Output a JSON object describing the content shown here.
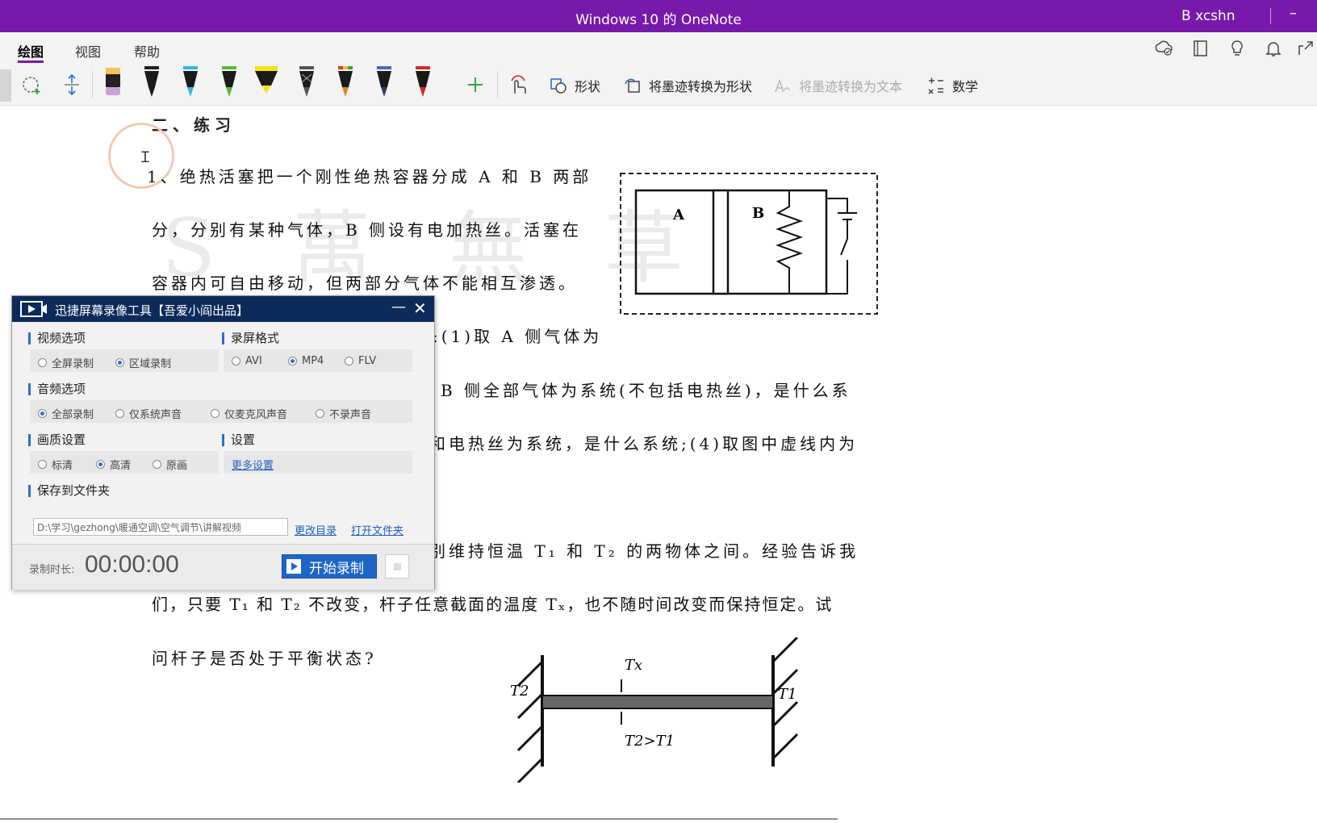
{
  "window": {
    "title": "Windows 10 的 OneNote",
    "user": "B xcshn",
    "minimize_glyph": "–"
  },
  "ribbon": {
    "tabs": [
      {
        "label": "绘图",
        "active": true
      },
      {
        "label": "视图"
      },
      {
        "label": "帮助"
      }
    ],
    "right_icons": [
      "sync-icon",
      "notebook-icon",
      "lightbulb-icon",
      "bell-icon",
      "share-icon"
    ]
  },
  "toolbar": {
    "shapes_label": "形状",
    "ink_to_shape_label": "将墨迹转换为形状",
    "ink_to_text_label": "将墨迹转换为文本",
    "math_label": "数学",
    "pen_colors": [
      "#1a1a1a",
      "#1a1a1a",
      "#35b5e5",
      "#57b83a",
      "#f2e61a",
      "#555555",
      "#e0802a",
      "#2c3c6a",
      "#d22a2a"
    ],
    "highlighter_color": "#c9a0d8"
  },
  "document": {
    "heading": "二、练习",
    "lines": [
      "1、绝热活塞把一个刚性绝热容器分成 A 和 B 两部",
      "分，分别有某种气体，B 侧设有电加热丝。活塞在",
      "容器内可自由移动，但两部分气体不能相互渗透。",
      ":(1)取 A 侧气体为",
      "B  侧全部气体为系统(不包括电热丝)，是什么系",
      "和电热丝为系统，是什么系统;(4)取图中虚线内为",
      "别维持恒温 T₁ 和 T₂ 的两物体之间。经验告诉我",
      "们，只要 T₁ 和 T₂ 不改变，杆子任意截面的温度 Tₓ，也不随时间改变而保持恒定。试",
      "问杆子是否处于平衡状态?"
    ],
    "figure1": {
      "label_a": "A",
      "label_b": "B"
    },
    "figure2": {
      "label_tx": "Tx",
      "label_t1": "T1",
      "label_t2": "T2",
      "label_rel": "T2>T1"
    }
  },
  "recorder": {
    "title": "迅捷屏幕录像工具【吾爱小阎出品】",
    "video_options": {
      "label": "视频选项",
      "options": [
        "全屏录制",
        "区域录制"
      ],
      "selected": "区域录制"
    },
    "format": {
      "label": "录屏格式",
      "options": [
        "AVI",
        "MP4",
        "FLV"
      ],
      "selected": "MP4"
    },
    "audio": {
      "label": "音频选项",
      "options": [
        "全部录制",
        "仅系统声音",
        "仅麦克风声音",
        "不录声音"
      ],
      "selected": "全部录制"
    },
    "quality": {
      "label": "画质设置",
      "options": [
        "标清",
        "高清",
        "原画"
      ],
      "selected": "高清"
    },
    "settings": {
      "label": "设置",
      "more_link": "更多设置"
    },
    "save": {
      "label": "保存到文件夹",
      "path": "D:\\学习\\gezhong\\暖通空调\\空气调节\\讲解视频",
      "change_link": "更改目录",
      "open_link": "打开文件夹"
    },
    "footer": {
      "duration_label": "录制时长:",
      "duration": "00:00:00",
      "start_label": "开始录制"
    }
  },
  "watermark": "S 萬 無 草"
}
